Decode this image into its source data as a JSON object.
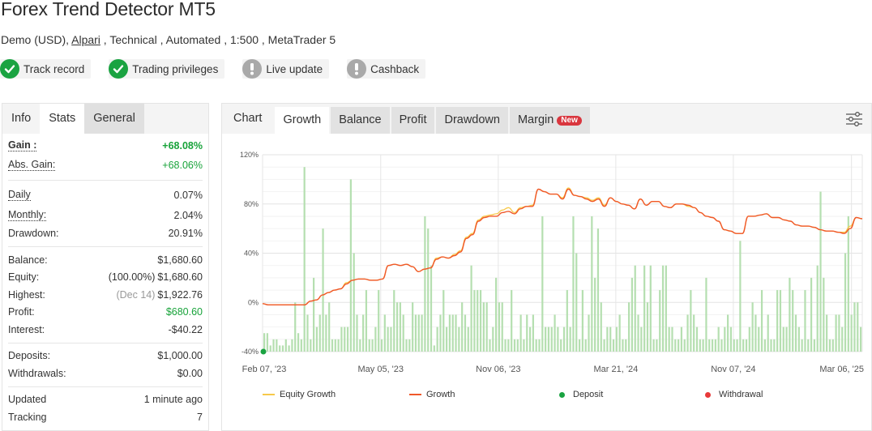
{
  "header": {
    "title": "Forex Trend Detector MT5",
    "subtitle_prefix": "Demo (USD), ",
    "broker_link": "Alpari",
    "subtitle_suffix": " , Technical , Automated , 1:500 , MetaTrader 5"
  },
  "badges": [
    {
      "label": "Track record",
      "status": "ok",
      "icon": "check-icon"
    },
    {
      "label": "Trading privileges",
      "status": "ok",
      "icon": "check-icon"
    },
    {
      "label": "Live update",
      "status": "warn",
      "icon": "exclamation-icon"
    },
    {
      "label": "Cashback",
      "status": "warn",
      "icon": "exclamation-icon"
    }
  ],
  "left_tabs": [
    {
      "label": "Info",
      "state": "inactive"
    },
    {
      "label": "Stats",
      "state": "active"
    },
    {
      "label": "General",
      "state": "grey"
    }
  ],
  "stats": {
    "gain": {
      "label": "Gain :",
      "value": "+68.08%"
    },
    "abs_gain": {
      "label": "Abs. Gain:",
      "value": "+68.06%"
    },
    "daily": {
      "label": "Daily",
      "value": "0.07%"
    },
    "monthly": {
      "label": "Monthly:",
      "value": "2.04%"
    },
    "drawdown": {
      "label": "Drawdown:",
      "value": "20.91%"
    },
    "balance": {
      "label": "Balance:",
      "value": "$1,680.60"
    },
    "equity": {
      "label": "Equity:",
      "note": "(100.00%)",
      "value": "$1,680.60"
    },
    "highest": {
      "label": "Highest:",
      "note": "(Dec 14)",
      "value": "$1,922.76"
    },
    "profit": {
      "label": "Profit:",
      "value": "$680.60"
    },
    "interest": {
      "label": "Interest:",
      "value": "-$40.22"
    },
    "deposits": {
      "label": "Deposits:",
      "value": "$1,000.00"
    },
    "withdrawals": {
      "label": "Withdrawals:",
      "value": "$0.00"
    },
    "updated": {
      "label": "Updated",
      "value": "1 minute ago"
    },
    "tracking": {
      "label": "Tracking",
      "value": "7"
    }
  },
  "chart_tabs": [
    {
      "label": "Chart",
      "state": "plain"
    },
    {
      "label": "Growth",
      "state": "active"
    },
    {
      "label": "Balance",
      "state": "grey"
    },
    {
      "label": "Profit",
      "state": "grey"
    },
    {
      "label": "Drawdown",
      "state": "grey"
    },
    {
      "label": "Margin",
      "state": "grey",
      "badge": "New"
    }
  ],
  "colors": {
    "accent_green": "#18a33a",
    "bars": "#b5dfb0",
    "growth": "#f0582a",
    "equity": "#f7c94a",
    "deposit": "#1aa341",
    "withdrawal": "#e83a3a",
    "new_badge": "#d9363e"
  },
  "chart_data": {
    "type": "line",
    "title": "",
    "xlabel": "",
    "ylabel": "",
    "ylim": [
      -40,
      120
    ],
    "yticks": [
      "120%",
      "80%",
      "40%",
      "0%",
      "-40%"
    ],
    "ytick_values": [
      120,
      80,
      40,
      0,
      -40
    ],
    "xticks": [
      "Feb 07, '23",
      "May 05, '23",
      "Nov 06, '23",
      "Mar 21, '24",
      "Nov 07, '24",
      "Mar 06, '25"
    ],
    "grid": true,
    "legend_position": "bottom",
    "legend": [
      {
        "name": "Equity Growth",
        "kind": "line",
        "color": "#f7c94a"
      },
      {
        "name": "Growth",
        "kind": "line",
        "color": "#f0582a"
      },
      {
        "name": "Deposit",
        "kind": "dot",
        "color": "#1aa341"
      },
      {
        "name": "Withdrawal",
        "kind": "dot",
        "color": "#e83a3a"
      }
    ],
    "x_range": [
      0,
      100
    ],
    "series": [
      {
        "name": "Growth",
        "x": [
          0,
          1,
          2,
          3,
          4,
          5,
          6,
          7,
          8,
          9,
          10,
          11,
          12,
          13,
          14,
          15,
          16,
          17,
          18,
          19,
          20,
          21,
          22,
          23,
          24,
          25,
          26,
          27,
          28,
          29,
          30,
          31,
          32,
          33,
          34,
          35,
          36,
          37,
          38,
          39,
          40,
          41,
          42,
          43,
          44,
          45,
          46,
          47,
          48,
          49,
          50,
          51,
          52,
          53,
          54,
          55,
          56,
          57,
          58,
          59,
          60,
          61,
          62,
          63,
          64,
          65,
          66,
          67,
          68,
          69,
          70,
          71,
          72,
          73,
          74,
          75,
          76,
          77,
          78,
          79,
          80,
          81,
          82,
          83,
          84,
          85,
          86,
          87,
          88,
          89,
          90,
          91,
          92,
          93,
          94,
          95,
          96,
          97,
          98,
          99,
          100
        ],
        "values": [
          -1,
          -2,
          -2,
          -2,
          -2,
          -2,
          -2,
          -2,
          1,
          2,
          6,
          8,
          10,
          11,
          15,
          18,
          19,
          19,
          18,
          18,
          19,
          30,
          31,
          30,
          31,
          29,
          25,
          27,
          28,
          35,
          37,
          36,
          38,
          41,
          52,
          55,
          66,
          69,
          70,
          70,
          73,
          74,
          72,
          76,
          78,
          78,
          92,
          90,
          88,
          88,
          84,
          92,
          87,
          86,
          84,
          82,
          84,
          78,
          85,
          82,
          80,
          79,
          76,
          84,
          79,
          82,
          82,
          78,
          77,
          80,
          80,
          79,
          77,
          73,
          70,
          69,
          66,
          59,
          58,
          56,
          56,
          70,
          70,
          71,
          72,
          69,
          69,
          67,
          66,
          63,
          62,
          62,
          61,
          59,
          58,
          58,
          57,
          56,
          60,
          69,
          68
        ],
        "color": "#f0582a"
      },
      {
        "name": "Equity Growth",
        "x": [
          0,
          1,
          2,
          3,
          4,
          5,
          6,
          7,
          8,
          9,
          10,
          11,
          12,
          13,
          14,
          15,
          16,
          17,
          18,
          19,
          20,
          21,
          22,
          23,
          24,
          25,
          26,
          27,
          28,
          29,
          30,
          31,
          32,
          33,
          34,
          35,
          36,
          37,
          38,
          39,
          40,
          41,
          42,
          43,
          44,
          45,
          46,
          47,
          48,
          49,
          50,
          51,
          52,
          53,
          54,
          55,
          56,
          57,
          58,
          59,
          60,
          61,
          62,
          63,
          64,
          65,
          66,
          67,
          68,
          69,
          70,
          71,
          72,
          73,
          74,
          75,
          76,
          77,
          78,
          79,
          80,
          81,
          82,
          83,
          84,
          85,
          86,
          87,
          88,
          89,
          90,
          91,
          92,
          93,
          94,
          95,
          96,
          97,
          98,
          99,
          100
        ],
        "values": [
          -1,
          -2,
          -2,
          -2,
          -2,
          -2,
          -2,
          -2,
          1,
          2,
          6,
          8,
          10,
          11,
          16,
          18,
          19,
          19,
          18,
          18,
          19,
          30,
          31,
          30,
          31,
          29,
          25,
          27,
          28,
          36,
          37,
          36,
          39,
          42,
          53,
          56,
          67,
          70,
          71,
          72,
          75,
          77,
          73,
          77,
          78,
          79,
          92,
          90,
          88,
          88,
          85,
          93,
          87,
          86,
          85,
          83,
          85,
          79,
          85,
          82,
          80,
          79,
          76,
          84,
          79,
          82,
          82,
          78,
          77,
          80,
          80,
          78,
          77,
          73,
          70,
          69,
          66,
          59,
          58,
          56,
          56,
          70,
          70,
          71,
          72,
          69,
          69,
          67,
          66,
          63,
          62,
          62,
          61,
          59,
          58,
          58,
          57,
          57,
          62,
          69,
          68
        ],
        "color": "#f7c94a"
      },
      {
        "name": "Activity",
        "kind": "bars",
        "values": [
          -25,
          -25,
          -35,
          -30,
          -30,
          -35,
          -35,
          -30,
          -35,
          -30,
          0,
          -25,
          -30,
          110,
          -10,
          -30,
          20,
          -20,
          -10,
          60,
          -10,
          0,
          -30,
          -30,
          -30,
          -20,
          -20,
          -20,
          100,
          40,
          -10,
          -30,
          -10,
          10,
          -30,
          -30,
          -20,
          10,
          -30,
          -10,
          -20,
          -20,
          10,
          0,
          0,
          -10,
          -30,
          -30,
          0,
          -10,
          -10,
          -10,
          70,
          60,
          30,
          -35,
          -20,
          -10,
          10,
          -20,
          -10,
          -10,
          -10,
          -20,
          0,
          -10,
          -20,
          30,
          10,
          10,
          10,
          0,
          0,
          -30,
          -20,
          20,
          0,
          0,
          -30,
          -30,
          10,
          -30,
          -30,
          -10,
          -30,
          -10,
          -20,
          -10,
          -30,
          -30,
          70,
          -20,
          -20,
          -20,
          -10,
          -20,
          -30,
          -20,
          10,
          -20,
          70,
          40,
          -30,
          10,
          -30,
          -10,
          70,
          20,
          60,
          0,
          -30,
          -20,
          -20,
          -30,
          -20,
          -10,
          -30,
          -30,
          0,
          20,
          30,
          -10,
          -20,
          30,
          0,
          30,
          -30,
          -30,
          10,
          30,
          30,
          -20,
          -20,
          -30,
          -30,
          -20,
          -30,
          -10,
          10,
          -10,
          -20,
          -30,
          -30,
          20,
          -30,
          -30,
          -30,
          -20,
          -30,
          -20,
          -10,
          -20,
          -30,
          -30,
          50,
          -30,
          -30,
          -20,
          0,
          -10,
          -20,
          10,
          -30,
          -10,
          -30,
          -30,
          10,
          10,
          -20,
          -20,
          20,
          10,
          -10,
          -20,
          -30,
          10,
          -30,
          20,
          -30,
          30,
          90,
          20,
          -10,
          -30,
          -30,
          -10,
          -10,
          -20,
          40,
          70,
          -10,
          0,
          0,
          -20
        ],
        "color": "#b5dfb0"
      },
      {
        "name": "Deposit",
        "kind": "points",
        "x": [
          0
        ],
        "values": [
          -40
        ],
        "color": "#1aa341"
      }
    ]
  }
}
